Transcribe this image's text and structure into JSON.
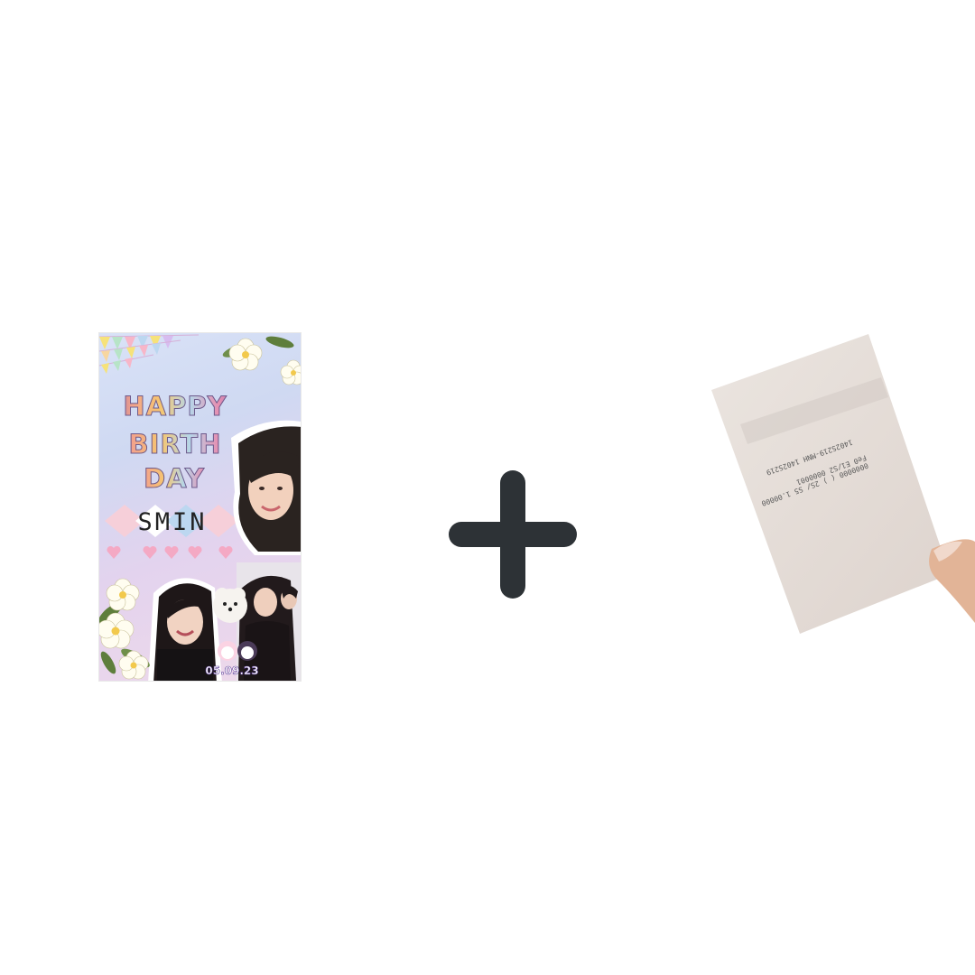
{
  "poster": {
    "title_line1": "HAPPY",
    "title_line2": "BIRTH",
    "title_line3": "DAY",
    "name": "SMIN",
    "date": "05.09.23",
    "colors": {
      "background_top": "#d9e2f7",
      "background_bottom": "#eed9ea",
      "diamond_pink": "#f6cfd9",
      "diamond_blue": "#bcd7f0",
      "heart": "#f4a9c4"
    }
  },
  "operator": {
    "icon": "plus-icon",
    "color": "#2d3236"
  },
  "receipt": {
    "lines": [
      "1402S219-MNH 1402S219",
      "Fe0 E1/S2  0000001",
      "0000000 ( ) 2S/ S5  1.00000"
    ],
    "paper_color": "#e9e2dd"
  }
}
